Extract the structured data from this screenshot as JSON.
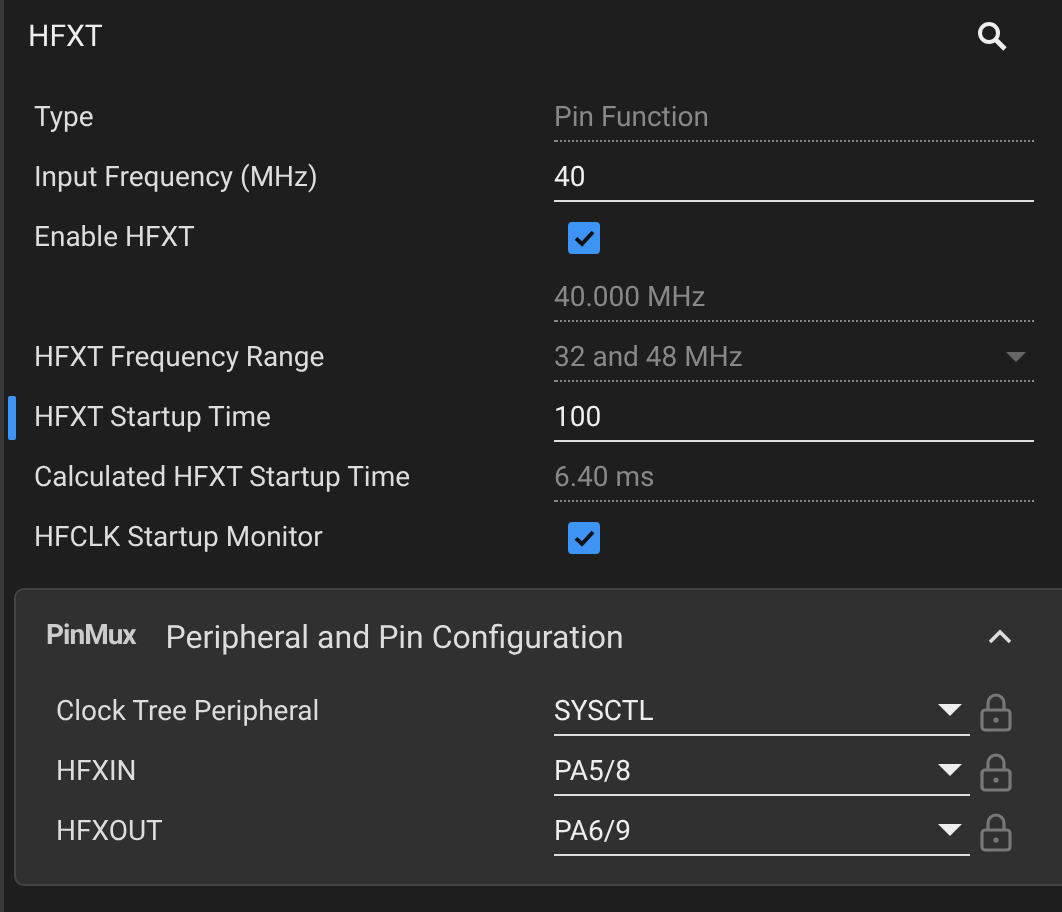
{
  "title": "HFXT",
  "rows": [
    {
      "label": "Type",
      "kind": "readonly",
      "value": "Pin Function",
      "selected": false
    },
    {
      "label": "Input Frequency (MHz)",
      "kind": "input",
      "value": "40",
      "selected": false
    },
    {
      "label": "Enable HFXT",
      "kind": "checkbox",
      "checked": true,
      "selected": false
    },
    {
      "label": "",
      "kind": "readonly",
      "value": "40.000 MHz",
      "selected": false
    },
    {
      "label": "HFXT Frequency Range",
      "kind": "readonly-select",
      "value": "32 and 48 MHz",
      "selected": false
    },
    {
      "label": "HFXT Startup Time",
      "kind": "input",
      "value": "100",
      "selected": true
    },
    {
      "label": "Calculated HFXT Startup Time",
      "kind": "readonly",
      "value": "6.40 ms",
      "selected": false
    },
    {
      "label": "HFCLK Startup Monitor",
      "kind": "checkbox",
      "checked": true,
      "selected": false
    }
  ],
  "panel": {
    "badge": "PinMux",
    "title": "Peripheral and Pin Configuration",
    "expanded": true,
    "rows": [
      {
        "label": "Clock Tree Peripheral",
        "value": "SYSCTL"
      },
      {
        "label": "HFXIN",
        "value": "PA5/8"
      },
      {
        "label": "HFXOUT",
        "value": "PA6/9"
      }
    ]
  }
}
